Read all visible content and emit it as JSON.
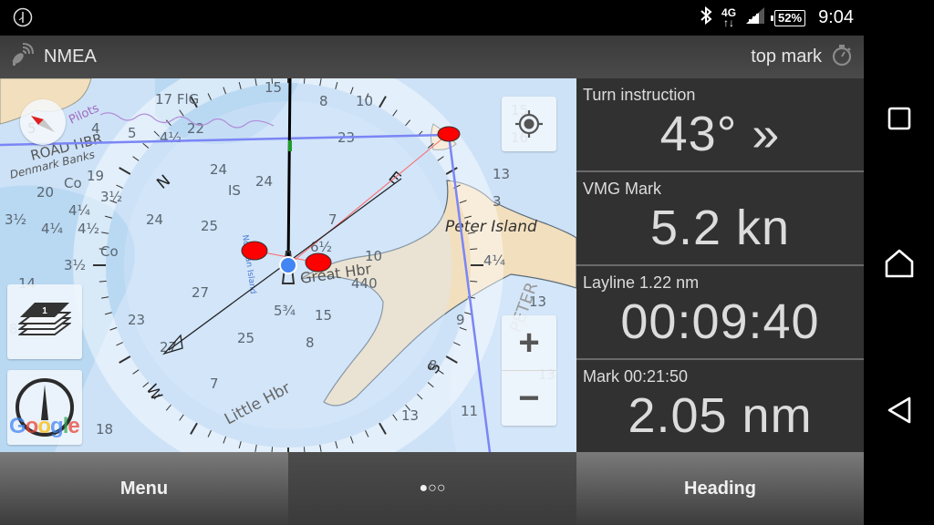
{
  "status_bar": {
    "left_icon": "info-clock-icon",
    "icons": [
      "bluetooth-icon",
      "4g-data-icon",
      "signal-icon",
      "battery-icon"
    ],
    "network": "4G",
    "battery": "52%",
    "time": "9:04"
  },
  "title_bar": {
    "left_icon": "satellite-dish-icon",
    "title": "NMEA",
    "right_label": "top mark",
    "right_icon": "stopwatch-icon"
  },
  "map": {
    "place_labels": [
      "Peter Island",
      "Great Hbr",
      "Little Hbr",
      "ROAD HBR",
      "Denmark Banks",
      "Pilots",
      "PETER",
      "Norman Island",
      "Co"
    ],
    "compass_labels": [
      "N",
      "E",
      "S",
      "W"
    ],
    "layers_badge": "1",
    "attribution": "Google",
    "controls": {
      "locate": "my-location-icon",
      "zoom_in": "+",
      "zoom_out": "−",
      "layers": "layers-icon",
      "north_mode": "compass-needle-icon",
      "mini_compass": "compass-arrow-icon"
    },
    "colors": {
      "mark": "#ff0000",
      "boat": "#4285f4",
      "course_line": "#7b86f5",
      "land": "#f2dfbe",
      "water": "#cfe3f8"
    }
  },
  "instruments": [
    {
      "label": "Turn instruction",
      "value": "43° »"
    },
    {
      "label": "VMG Mark",
      "value": "5.2 kn"
    },
    {
      "label": "Layline 1.22 nm",
      "value": "00:09:40"
    },
    {
      "label": "Mark 00:21:50",
      "value": "2.05 nm"
    }
  ],
  "bottom_bar": {
    "left": "Menu",
    "center": "●○○",
    "right": "Heading"
  },
  "nav_bar": {
    "recents": "recents-icon",
    "home": "home-icon",
    "back": "back-icon"
  }
}
